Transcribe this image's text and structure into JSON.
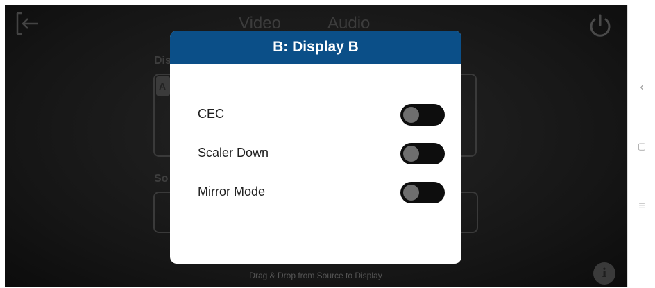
{
  "tabs": [
    {
      "label": "Video"
    },
    {
      "label": "Audio"
    }
  ],
  "sections": {
    "display_label": "Dis",
    "source_label": "So",
    "tile_label": "A"
  },
  "hint": "Drag & Drop from Source to Display",
  "info_glyph": "i",
  "modal": {
    "title": "B: Display B",
    "options": [
      {
        "label": "CEC",
        "enabled": false
      },
      {
        "label": "Scaler Down",
        "enabled": false
      },
      {
        "label": "Mirror Mode",
        "enabled": false
      }
    ]
  },
  "colors": {
    "header": "#0b4f88",
    "toggle_off": "#0d0d0d",
    "knob": "#6e6e6e"
  },
  "nav": {
    "back_glyph": "‹",
    "home_glyph": "▢",
    "menu_glyph": "≡"
  },
  "icons": [
    "back-arrow-icon",
    "power-icon",
    "info-icon",
    "android-back-icon",
    "android-home-icon",
    "android-menu-icon"
  ]
}
